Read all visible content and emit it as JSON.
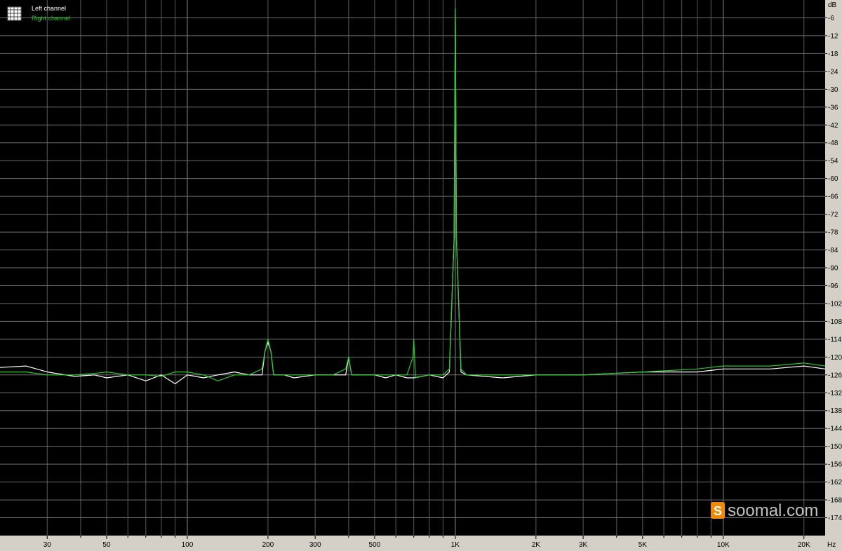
{
  "watermark": "soomal.com",
  "chart_data": {
    "type": "line",
    "title": "",
    "xlabel": "",
    "ylabel": "",
    "x_unit": "Hz",
    "y_unit": "dB",
    "x_scale": "log",
    "xlim": [
      20,
      24000
    ],
    "ylim": [
      -180,
      0
    ],
    "grid": true,
    "legend": "top-left",
    "x_tick_labels": [
      {
        "value": 30,
        "label": "30"
      },
      {
        "value": 50,
        "label": "50"
      },
      {
        "value": 100,
        "label": "100"
      },
      {
        "value": 200,
        "label": "200"
      },
      {
        "value": 300,
        "label": "300"
      },
      {
        "value": 500,
        "label": "500"
      },
      {
        "value": 1000,
        "label": "1K"
      },
      {
        "value": 2000,
        "label": "2K"
      },
      {
        "value": 3000,
        "label": "3K"
      },
      {
        "value": 5000,
        "label": "5K"
      },
      {
        "value": 10000,
        "label": "10K"
      },
      {
        "value": 20000,
        "label": "20K"
      }
    ],
    "y_ticks": [
      -6,
      -12,
      -18,
      -24,
      -30,
      -36,
      -42,
      -48,
      -54,
      -60,
      -66,
      -72,
      -78,
      -84,
      -90,
      -96,
      -102,
      -108,
      -114,
      -120,
      -126,
      -132,
      -138,
      -144,
      -150,
      -156,
      -162,
      -168,
      -174
    ],
    "series": [
      {
        "name": "Left channel",
        "color": "#ffffff",
        "points": [
          [
            20,
            -123.5
          ],
          [
            25,
            -123
          ],
          [
            30,
            -125
          ],
          [
            38,
            -126.5
          ],
          [
            45,
            -126
          ],
          [
            50,
            -127
          ],
          [
            60,
            -126
          ],
          [
            70,
            -128
          ],
          [
            80,
            -126
          ],
          [
            90,
            -129
          ],
          [
            100,
            -126
          ],
          [
            115,
            -127
          ],
          [
            130,
            -126
          ],
          [
            150,
            -125
          ],
          [
            170,
            -126
          ],
          [
            190,
            -126
          ],
          [
            195,
            -118
          ],
          [
            200,
            -115
          ],
          [
            205,
            -118
          ],
          [
            210,
            -126
          ],
          [
            230,
            -126
          ],
          [
            250,
            -127
          ],
          [
            300,
            -126
          ],
          [
            350,
            -126
          ],
          [
            390,
            -126
          ],
          [
            400,
            -120
          ],
          [
            410,
            -126
          ],
          [
            450,
            -126
          ],
          [
            500,
            -126
          ],
          [
            550,
            -127
          ],
          [
            600,
            -126
          ],
          [
            660,
            -127
          ],
          [
            700,
            -127
          ],
          [
            800,
            -126
          ],
          [
            900,
            -127
          ],
          [
            950,
            -125
          ],
          [
            990,
            -80
          ],
          [
            1000,
            -3
          ],
          [
            1010,
            -80
          ],
          [
            1050,
            -125
          ],
          [
            1100,
            -126
          ],
          [
            1500,
            -127
          ],
          [
            2000,
            -126
          ],
          [
            3000,
            -126
          ],
          [
            5000,
            -125
          ],
          [
            8000,
            -125
          ],
          [
            10000,
            -124
          ],
          [
            15000,
            -124
          ],
          [
            20000,
            -123
          ],
          [
            24000,
            -124
          ]
        ]
      },
      {
        "name": "Right channel",
        "color": "#22cc22",
        "points": [
          [
            20,
            -125
          ],
          [
            25,
            -125
          ],
          [
            30,
            -126
          ],
          [
            38,
            -126
          ],
          [
            45,
            -125.5
          ],
          [
            50,
            -125
          ],
          [
            60,
            -126
          ],
          [
            70,
            -126
          ],
          [
            80,
            -126.5
          ],
          [
            90,
            -125
          ],
          [
            100,
            -125
          ],
          [
            115,
            -126
          ],
          [
            130,
            -128
          ],
          [
            150,
            -126
          ],
          [
            170,
            -126
          ],
          [
            190,
            -124
          ],
          [
            195,
            -118
          ],
          [
            200,
            -114
          ],
          [
            205,
            -118
          ],
          [
            210,
            -126
          ],
          [
            250,
            -126
          ],
          [
            300,
            -126
          ],
          [
            350,
            -126
          ],
          [
            390,
            -124
          ],
          [
            400,
            -120
          ],
          [
            410,
            -126
          ],
          [
            500,
            -126
          ],
          [
            600,
            -126
          ],
          [
            660,
            -126
          ],
          [
            695,
            -120
          ],
          [
            700,
            -114
          ],
          [
            705,
            -120
          ],
          [
            710,
            -127
          ],
          [
            800,
            -126
          ],
          [
            900,
            -126
          ],
          [
            950,
            -124
          ],
          [
            990,
            -80
          ],
          [
            1000,
            -3
          ],
          [
            1010,
            -80
          ],
          [
            1050,
            -124
          ],
          [
            1100,
            -126
          ],
          [
            1500,
            -126
          ],
          [
            2000,
            -126
          ],
          [
            3000,
            -126
          ],
          [
            5000,
            -125
          ],
          [
            8000,
            -124
          ],
          [
            10000,
            -123
          ],
          [
            15000,
            -123
          ],
          [
            20000,
            -122
          ],
          [
            24000,
            -123
          ]
        ]
      }
    ]
  }
}
